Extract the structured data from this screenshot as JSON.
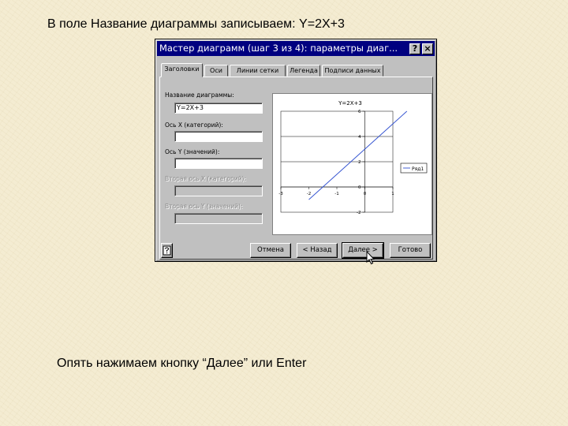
{
  "slide": {
    "heading": "В поле Название диаграммы записываем: Y=2X+3",
    "footer_note": "Опять нажимаем кнопку “Далее” или Enter"
  },
  "dialog": {
    "title": "Мастер диаграмм (шаг 3 из 4): параметры диаг...",
    "help_glyph": "?",
    "close_glyph": "×",
    "tabs": [
      {
        "label": "Заголовки",
        "active": true
      },
      {
        "label": "Оси",
        "active": false
      },
      {
        "label": "Линии сетки",
        "active": false
      },
      {
        "label": "Легенда",
        "active": false
      },
      {
        "label": "Подписи данных",
        "active": false
      }
    ],
    "fields": {
      "chart_title": {
        "label": "Название диаграммы:",
        "value": "Y=2X+3",
        "enabled": true
      },
      "x_axis": {
        "label": "Ось X (категорий):",
        "value": "",
        "enabled": true
      },
      "y_axis": {
        "label": "Ось Y (значений):",
        "value": "",
        "enabled": true
      },
      "x2_axis": {
        "label": "Вторая ось X (категорий):",
        "value": "",
        "enabled": false
      },
      "y2_axis": {
        "label": "Вторая ось Y (значений):",
        "value": "",
        "enabled": false
      }
    },
    "buttons": {
      "cancel": "Отмена",
      "back": "< Назад",
      "next": "Далее >",
      "finish": "Готово"
    },
    "icons": {
      "assistant": "office-assistant-icon",
      "cursor": "mouse-pointer-icon"
    },
    "colors": {
      "titlebar": "#000080",
      "face": "#c0c0c0",
      "series_line": "#3050d0"
    }
  },
  "chart_data": {
    "type": "line",
    "title": "Y=2X+3",
    "xlabel": "",
    "ylabel": "",
    "x_ticks": [
      "-3",
      "-2",
      "-1",
      "0",
      "1"
    ],
    "y_ticks": [
      "6",
      "4",
      "2",
      "0",
      "-2"
    ],
    "xlim": [
      -3,
      1
    ],
    "ylim": [
      -2,
      6
    ],
    "series": [
      {
        "name": "Ряд1",
        "x": [
          -2,
          -1.5,
          -1,
          -0.5,
          0,
          0.5,
          1,
          1.5
        ],
        "y": [
          -1,
          0,
          1,
          2,
          3,
          4,
          5,
          6
        ]
      }
    ],
    "legend": "right",
    "grid": true
  }
}
